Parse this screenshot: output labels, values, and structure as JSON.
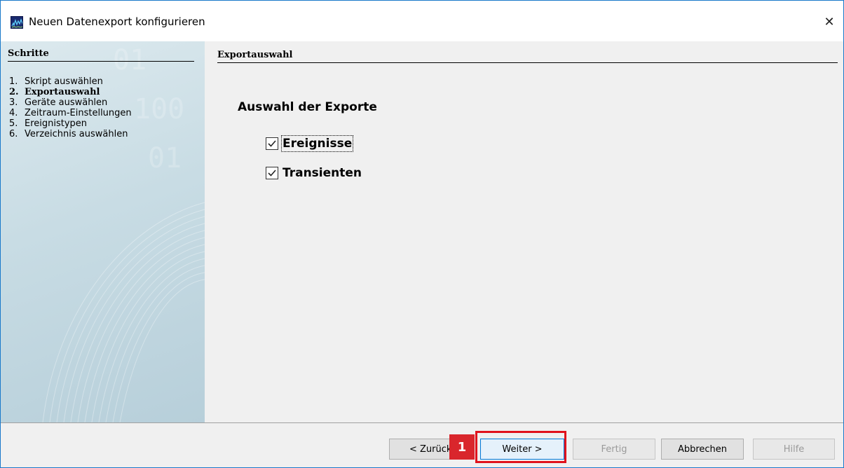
{
  "window": {
    "title": "Neuen Datenexport konfigurieren",
    "close_glyph": "✕"
  },
  "sidebar": {
    "title": "Schritte",
    "steps": [
      {
        "num": "1.",
        "label": "Skript auswählen"
      },
      {
        "num": "2.",
        "label": "Exportauswahl"
      },
      {
        "num": "3.",
        "label": "Geräte auswählen"
      },
      {
        "num": "4.",
        "label": "Zeitraum-Einstellungen"
      },
      {
        "num": "5.",
        "label": "Ereignistypen"
      },
      {
        "num": "6.",
        "label": "Verzeichnis auswählen"
      }
    ],
    "active_index": 1
  },
  "main": {
    "section_title": "Exportauswahl",
    "group_heading": "Auswahl der Exporte",
    "options": [
      {
        "label": "Ereignisse",
        "checked": true
      },
      {
        "label": "Transienten",
        "checked": true
      }
    ]
  },
  "footer": {
    "back_label": "< Zurück",
    "next_label": "Weiter >",
    "finish_label": "Fertig",
    "cancel_label": "Abbrechen",
    "help_label": "Hilfe"
  },
  "annotation": {
    "badge_number": "1",
    "color": "#e0121c"
  },
  "colors": {
    "accent": "#0078d7",
    "window_border": "#1979ca",
    "highlight": "#e0121c"
  }
}
